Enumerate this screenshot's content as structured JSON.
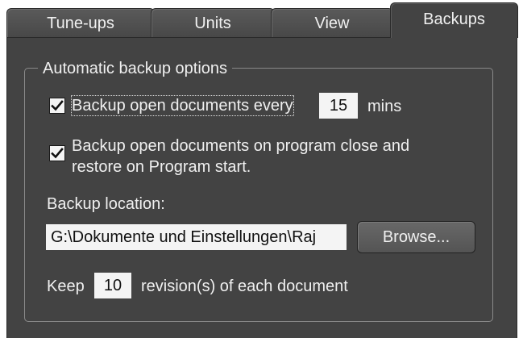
{
  "tabs": [
    {
      "label": "Tune-ups",
      "active": false
    },
    {
      "label": "Units",
      "active": false
    },
    {
      "label": "View",
      "active": false
    },
    {
      "label": "Backups",
      "active": true
    }
  ],
  "group": {
    "title": "Automatic backup options",
    "backup_every": {
      "checked": true,
      "label": "Backup open documents every",
      "value": "15",
      "unit": "mins"
    },
    "backup_on_close": {
      "checked": true,
      "label_line1": "Backup open documents on program close and",
      "label_line2": "restore on Program start."
    },
    "location": {
      "label": "Backup location:",
      "value": "G:\\Dokumente und Einstellungen\\Raj",
      "browse_label": "Browse..."
    },
    "revisions": {
      "prefix": "Keep",
      "value": "10",
      "suffix": "revision(s) of each document"
    }
  },
  "colors": {
    "panel_bg": "#434343",
    "tab_bg": "#525252",
    "text": "#f0f0f0",
    "field_bg": "#f4f4f4",
    "group_border": "#8a8a8a"
  },
  "icons": {
    "checkmark": "checkmark-icon"
  }
}
